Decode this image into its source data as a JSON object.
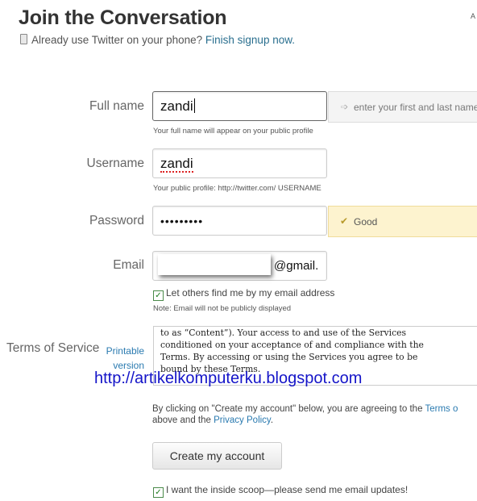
{
  "header": {
    "title": "Join the Conversation",
    "corner_glyph": "A",
    "phone_text": "Already use Twitter on your phone?",
    "phone_link": "Finish signup now."
  },
  "form": {
    "fullname": {
      "label": "Full name",
      "value": "zandi",
      "hint": "Your full name will appear on your public profile",
      "tip": "enter your first and last name"
    },
    "username": {
      "label": "Username",
      "value": "zandi",
      "hint": "Your public profile: http://twitter.com/ USERNAME"
    },
    "password": {
      "label": "Password",
      "value": "•••••••••",
      "tip": "Good"
    },
    "email": {
      "label": "Email",
      "suffix": "@gmail.",
      "checkbox_label": "Let others find me by my email address",
      "note": "Note: Email will not be publicly displayed"
    },
    "tos": {
      "label": "Terms of Service",
      "printable": "Printable version",
      "text": "to as “Content”). Your access to and use of the Services\nconditioned on your acceptance of and compliance with the\nTerms. By accessing or using the Services you agree to be\nbound by these Terms."
    }
  },
  "watermark": "http://artikelkomputerku.blogspot.com",
  "agreement": {
    "prefix": "By clicking on \"Create my account\" below, you are agreeing to the",
    "terms_link": "Terms o",
    "middle": "above and the",
    "privacy_link": "Privacy Policy",
    "suffix": "."
  },
  "submit_label": "Create my account",
  "scoop_label": "I want the inside scoop—please send me email updates!"
}
